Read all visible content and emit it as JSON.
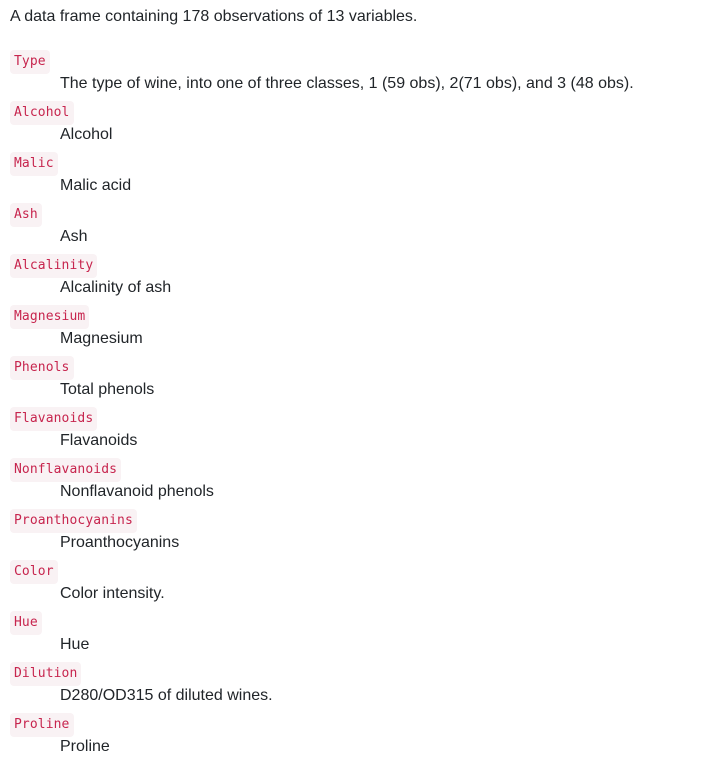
{
  "intro": "A data frame containing 178 observations of 13 variables.",
  "variables": [
    {
      "name": "Type",
      "description": "The type of wine, into one of three classes, 1 (59 obs), 2(71 obs), and 3 (48 obs)."
    },
    {
      "name": "Alcohol",
      "description": "Alcohol"
    },
    {
      "name": "Malic",
      "description": "Malic acid"
    },
    {
      "name": "Ash",
      "description": "Ash"
    },
    {
      "name": "Alcalinity",
      "description": "Alcalinity of ash"
    },
    {
      "name": "Magnesium",
      "description": "Magnesium"
    },
    {
      "name": "Phenols",
      "description": "Total phenols"
    },
    {
      "name": "Flavanoids",
      "description": "Flavanoids"
    },
    {
      "name": "Nonflavanoids",
      "description": "Nonflavanoid phenols"
    },
    {
      "name": "Proanthocyanins",
      "description": "Proanthocyanins"
    },
    {
      "name": "Color",
      "description": "Color intensity."
    },
    {
      "name": "Hue",
      "description": "Hue"
    },
    {
      "name": "Dilution",
      "description": "D280/OD315 of diluted wines."
    },
    {
      "name": "Proline",
      "description": "Proline"
    }
  ],
  "colors": {
    "code_text": "#c7254e",
    "code_background": "#f9f2f4",
    "body_text": "#212529"
  }
}
